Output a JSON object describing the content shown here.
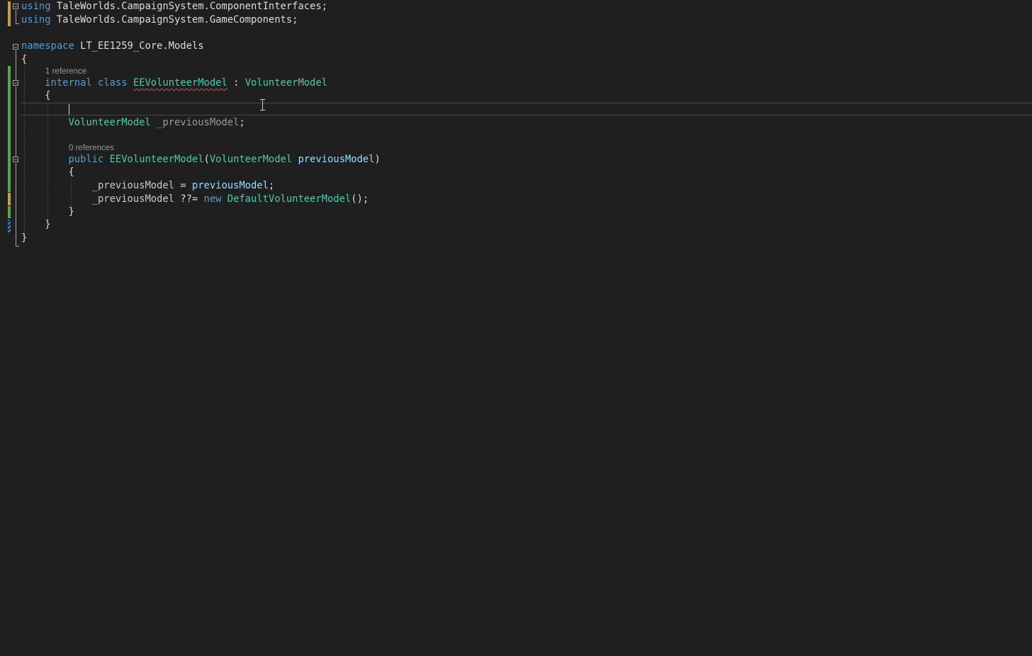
{
  "editor": {
    "language": "C#",
    "colors": {
      "background": "#1f1f1f",
      "keyword": "#569cd6",
      "type": "#4ec9b0",
      "parameter": "#9cdcfe",
      "plain": "#dcdcdc",
      "comment_hint": "#999999",
      "change_saved": "#57a64a",
      "change_unsaved": "#c2a03a",
      "error_squiggle": "#e04848"
    },
    "lines": {
      "using1": {
        "kw": "using",
        "rest": " TaleWorlds.CampaignSystem.ComponentInterfaces;"
      },
      "using2": {
        "kw": "using",
        "rest": " TaleWorlds.CampaignSystem.GameComponents;"
      },
      "ns": {
        "kw": "namespace",
        "rest": " LT_EE1259_Core.Models"
      },
      "ns_open": "{",
      "class_refs": "1 reference",
      "class_decl": {
        "kw_internal": "internal",
        "kw_class": "class",
        "name": "EEVolunteerModel",
        "colon": " : ",
        "base": "VolunteerModel"
      },
      "class_open": "{",
      "field": {
        "type": "VolunteerModel",
        "name": "_previousModel",
        "end": ";"
      },
      "ctor_refs": "0 references",
      "ctor_decl": {
        "kw_public": "public",
        "name": "EEVolunteerModel",
        "open_paren": "(",
        "param_type": "VolunteerModel",
        "param_name": "previousModel",
        "close_paren": ")"
      },
      "ctor_open": "{",
      "assign1": {
        "lhs": "_previousModel",
        "op": " = ",
        "rhs": "previousModel",
        "end": ";"
      },
      "assign2": {
        "lhs": "_previousModel",
        "op": " ??= ",
        "kw_new": "new",
        "type": "DefaultVolunteerModel",
        "end": "();"
      },
      "ctor_close": "}",
      "class_close": "}",
      "ns_close": "}"
    }
  }
}
